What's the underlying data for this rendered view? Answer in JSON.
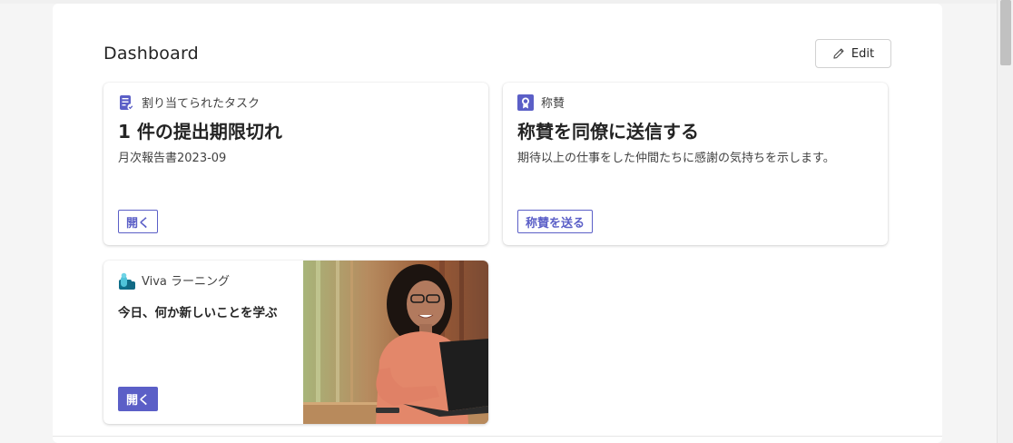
{
  "dashboard": {
    "title": "Dashboard",
    "edit_label": "Edit"
  },
  "cards": [
    {
      "app": "割り当てられたタスク",
      "icon": "task-list-icon",
      "title": "1 件の提出期限切れ",
      "subtitle": "月次報告書2023-09",
      "action": "開く"
    },
    {
      "app": "称賛",
      "icon": "praise-badge-icon",
      "title": "称賛を同僚に送信する",
      "subtitle": "期待以上の仕事をした仲間たちに感謝の気持ちを示します。",
      "action": "称賛を送る"
    },
    {
      "app": "Viva ラーニング",
      "icon": "viva-learning-icon",
      "subtitle": "今日、何か新しいことを学ぶ",
      "action": "開く",
      "image": "woman-with-laptop-photo"
    }
  ],
  "colors": {
    "accent": "#5b5fc7",
    "background": "#f5f5f5"
  }
}
